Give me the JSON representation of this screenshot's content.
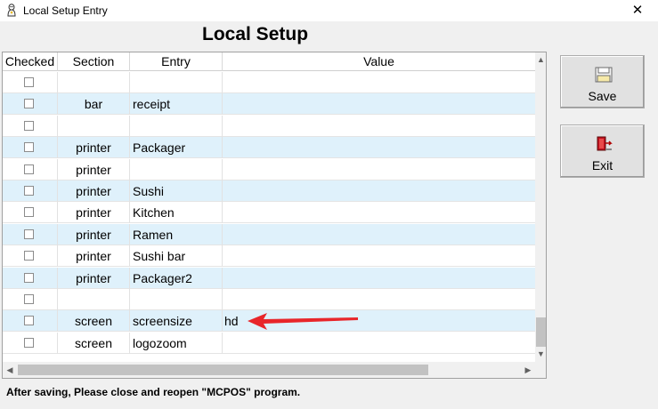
{
  "window": {
    "title": "Local Setup Entry",
    "close_label": "✕"
  },
  "heading": "Local Setup",
  "grid": {
    "columns": [
      "Checked",
      "Section",
      "Entry",
      "Value"
    ],
    "rows": [
      {
        "section": "",
        "entry": "",
        "value": ""
      },
      {
        "section": "bar",
        "entry": "receipt",
        "value": ""
      },
      {
        "section": "",
        "entry": "",
        "value": ""
      },
      {
        "section": "printer",
        "entry": "Packager",
        "value": ""
      },
      {
        "section": "printer",
        "entry": "",
        "value": ""
      },
      {
        "section": "printer",
        "entry": "Sushi",
        "value": ""
      },
      {
        "section": "printer",
        "entry": "Kitchen",
        "value": ""
      },
      {
        "section": "printer",
        "entry": "Ramen",
        "value": ""
      },
      {
        "section": "printer",
        "entry": "Sushi bar",
        "value": ""
      },
      {
        "section": "printer",
        "entry": "Packager2",
        "value": ""
      },
      {
        "section": "",
        "entry": "",
        "value": ""
      },
      {
        "section": "screen",
        "entry": "screensize",
        "value": "hd"
      },
      {
        "section": "screen",
        "entry": "logozoom",
        "value": ""
      }
    ]
  },
  "buttons": {
    "save": "Save",
    "exit": "Exit"
  },
  "hint": "After saving, Please close and  reopen \"MCPOS\" program.",
  "colors": {
    "row_alt": "#dff1fb",
    "arrow": "#e8262b"
  },
  "icons": {
    "save": "floppy-disk-icon",
    "exit": "exit-door-icon",
    "app": "app-icon"
  }
}
